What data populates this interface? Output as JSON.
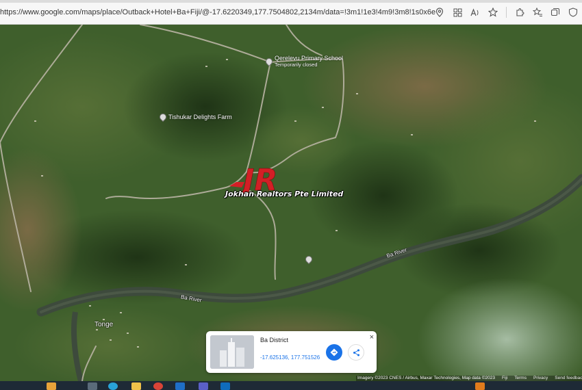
{
  "browser": {
    "url": "https://www.google.com/maps/place/Outback+Hotel+Ba+Fiji/@-17.6220349,177.7504802,2134m/data=!3m1!1e3!4m9!3m8!1s0x6e19c24475b2a1b1:0xe..."
  },
  "map": {
    "view": "satellite",
    "places": {
      "school_name": "Qerelevu Primary School",
      "school_status": "Temporarily closed",
      "farm_name": "Tishukar Delights Farm",
      "town_name": "Tonge"
    },
    "river_labels": [
      "Ba River",
      "Ba River"
    ],
    "watermark": {
      "logo_text": "JR",
      "company": "Jokhan Realtors Pte Limited"
    },
    "colors": {
      "vegetation": "#3f5f2c",
      "river": "#3d4a3c",
      "road": "#b9b4a4",
      "logo_red": "#d31f26"
    }
  },
  "info_card": {
    "title": "Ba District",
    "coords": "-17.625136, 177.751526",
    "close": "×"
  },
  "attribution": {
    "imagery": "Imagery ©2023 CNES / Airbus, Maxar Technologies, Map data ©2023",
    "country": "Fiji",
    "terms": "Terms",
    "privacy": "Privacy",
    "feedback": "Send feedback"
  }
}
